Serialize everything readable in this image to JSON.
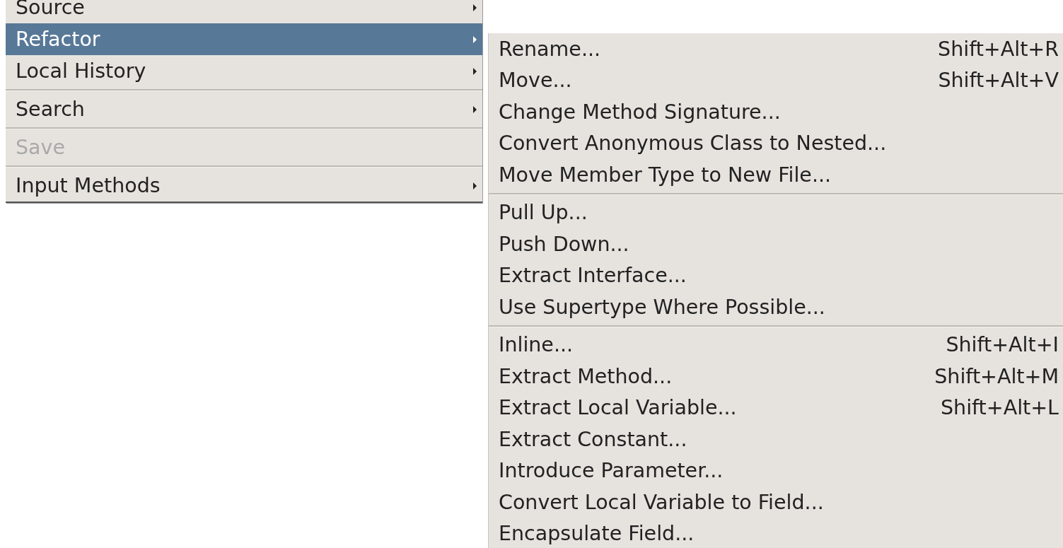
{
  "main_menu": {
    "items": [
      {
        "kind": "item",
        "label": "Source",
        "submenu": true,
        "selected": false,
        "disabled": false
      },
      {
        "kind": "item",
        "label": "Refactor",
        "submenu": true,
        "selected": true,
        "disabled": false
      },
      {
        "kind": "item",
        "label": "Local History",
        "submenu": true,
        "selected": false,
        "disabled": false
      },
      {
        "kind": "separator"
      },
      {
        "kind": "item",
        "label": "Search",
        "submenu": true,
        "selected": false,
        "disabled": false
      },
      {
        "kind": "separator"
      },
      {
        "kind": "item",
        "label": "Save",
        "submenu": false,
        "selected": false,
        "disabled": true
      },
      {
        "kind": "separator"
      },
      {
        "kind": "item",
        "label": "Input Methods",
        "submenu": true,
        "selected": false,
        "disabled": false
      }
    ]
  },
  "refactor_submenu": {
    "items": [
      {
        "kind": "item",
        "label": "Rename...",
        "shortcut": "Shift+Alt+R"
      },
      {
        "kind": "item",
        "label": "Move...",
        "shortcut": "Shift+Alt+V"
      },
      {
        "kind": "item",
        "label": "Change Method Signature..."
      },
      {
        "kind": "item",
        "label": "Convert Anonymous Class to Nested..."
      },
      {
        "kind": "item",
        "label": "Move Member Type to New File..."
      },
      {
        "kind": "separator"
      },
      {
        "kind": "item",
        "label": "Pull Up..."
      },
      {
        "kind": "item",
        "label": "Push Down..."
      },
      {
        "kind": "item",
        "label": "Extract Interface..."
      },
      {
        "kind": "item",
        "label": "Use Supertype Where Possible..."
      },
      {
        "kind": "separator"
      },
      {
        "kind": "item",
        "label": "Inline...",
        "shortcut": "Shift+Alt+I"
      },
      {
        "kind": "item",
        "label": "Extract Method...",
        "shortcut": "Shift+Alt+M"
      },
      {
        "kind": "item",
        "label": "Extract Local Variable...",
        "shortcut": "Shift+Alt+L"
      },
      {
        "kind": "item",
        "label": "Extract Constant..."
      },
      {
        "kind": "item",
        "label": "Introduce Parameter..."
      },
      {
        "kind": "item",
        "label": "Convert Local Variable to Field..."
      },
      {
        "kind": "item",
        "label": "Encapsulate Field..."
      }
    ]
  }
}
